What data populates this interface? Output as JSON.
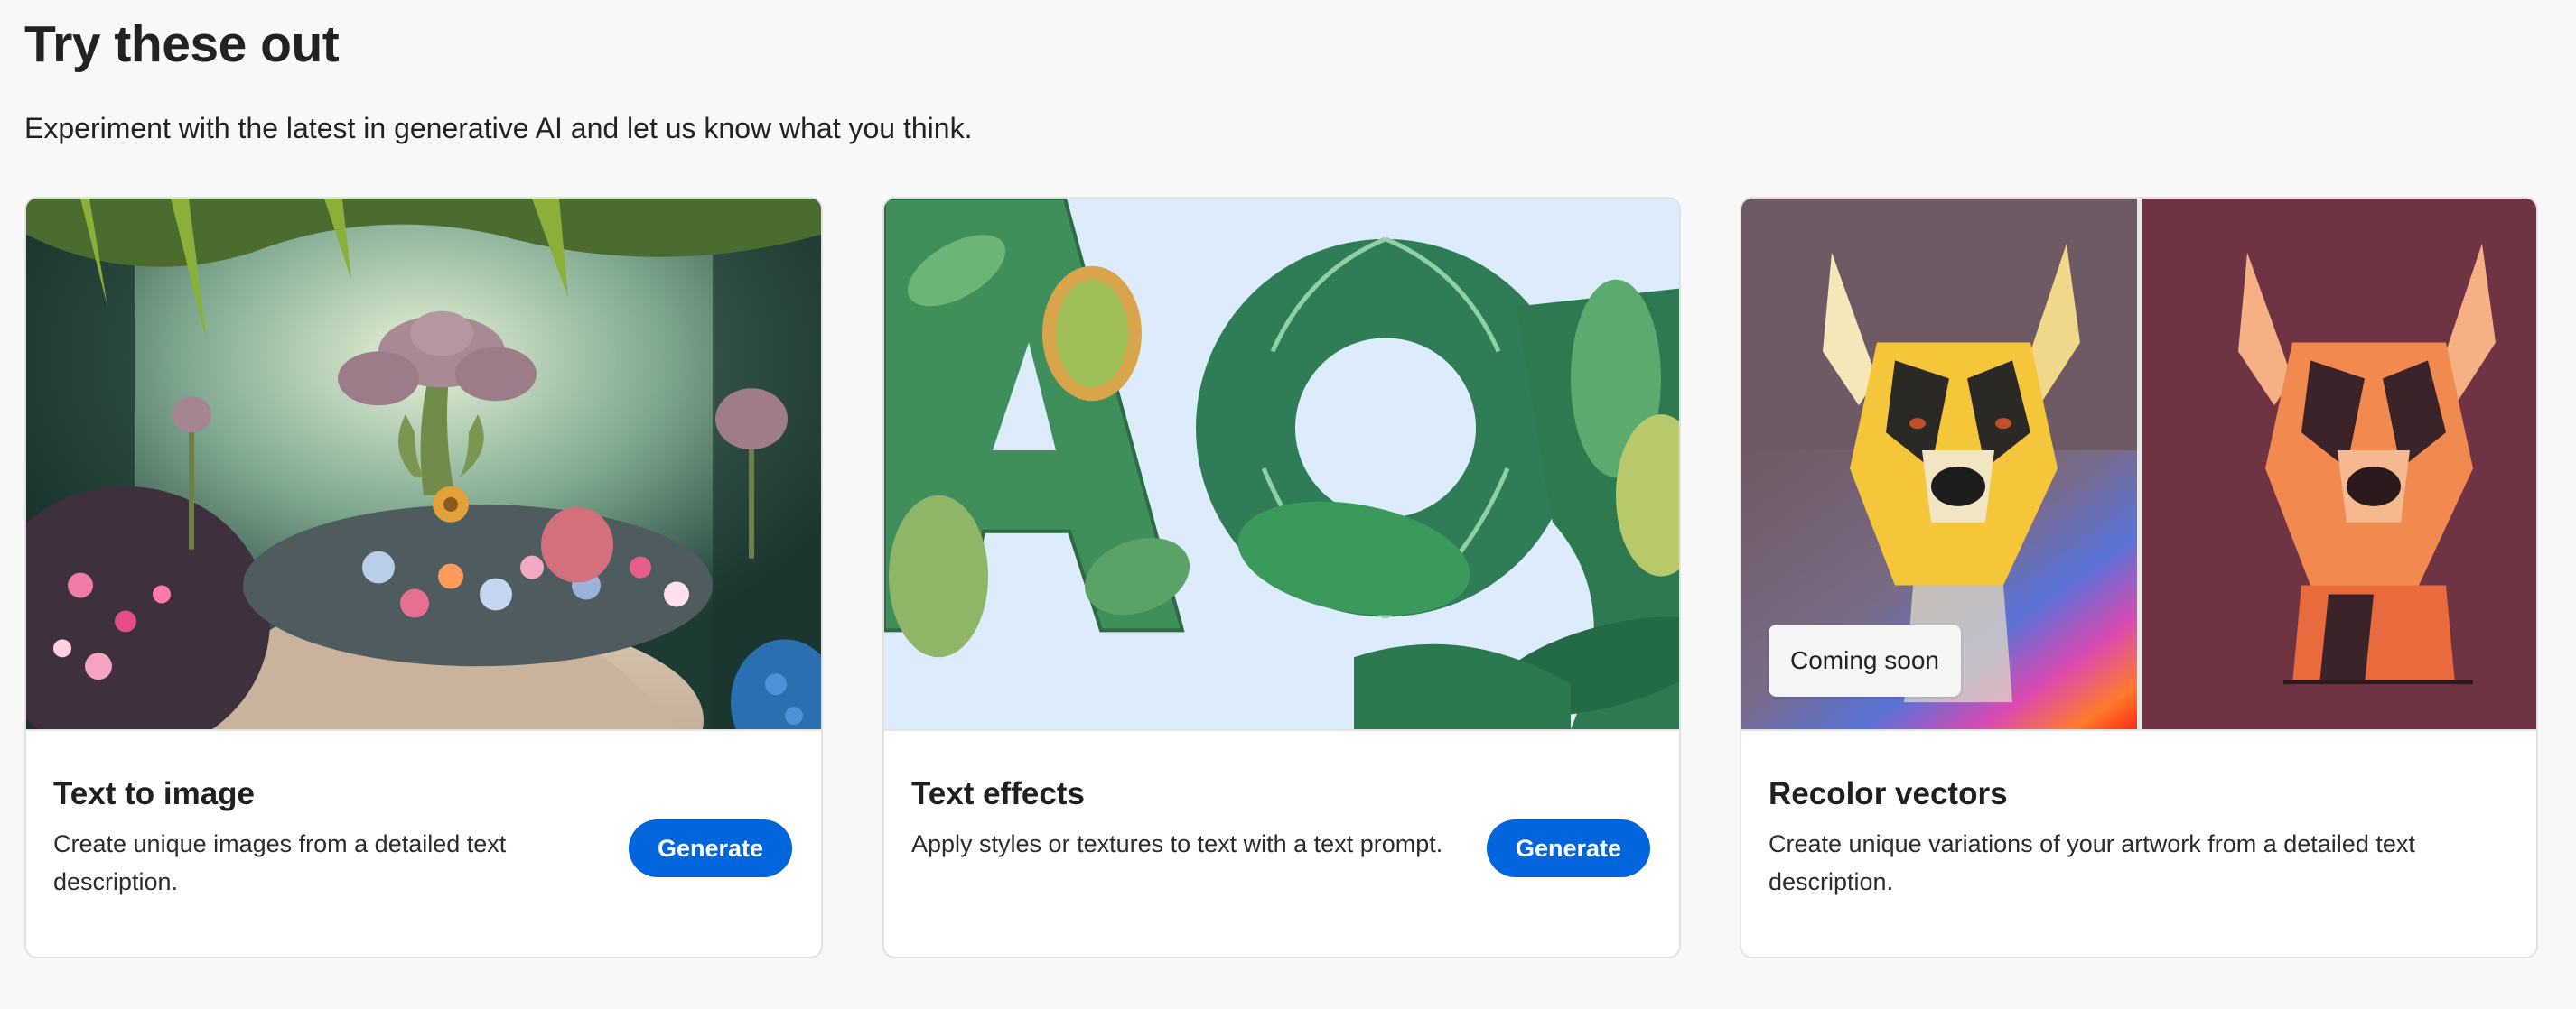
{
  "header": {
    "title": "Try these out",
    "subtitle": "Experiment with the latest in generative AI and let us know what you think."
  },
  "cards": [
    {
      "title": "Text to image",
      "description": "Create unique images from a detailed text description.",
      "button_label": "Generate",
      "image": "fantasy-garden-image"
    },
    {
      "title": "Text effects",
      "description": "Apply styles or textures to text with a text prompt.",
      "button_label": "Generate",
      "image": "leaf-letters-image"
    },
    {
      "title": "Recolor vectors",
      "description": "Create unique variations of your artwork from a detailed text description.",
      "badge": "Coming soon",
      "image": "recolored-dog-image"
    }
  ],
  "colors": {
    "accent": "#0265dc",
    "background": "#f8f8f8",
    "card_border": "#e1e1e1"
  }
}
